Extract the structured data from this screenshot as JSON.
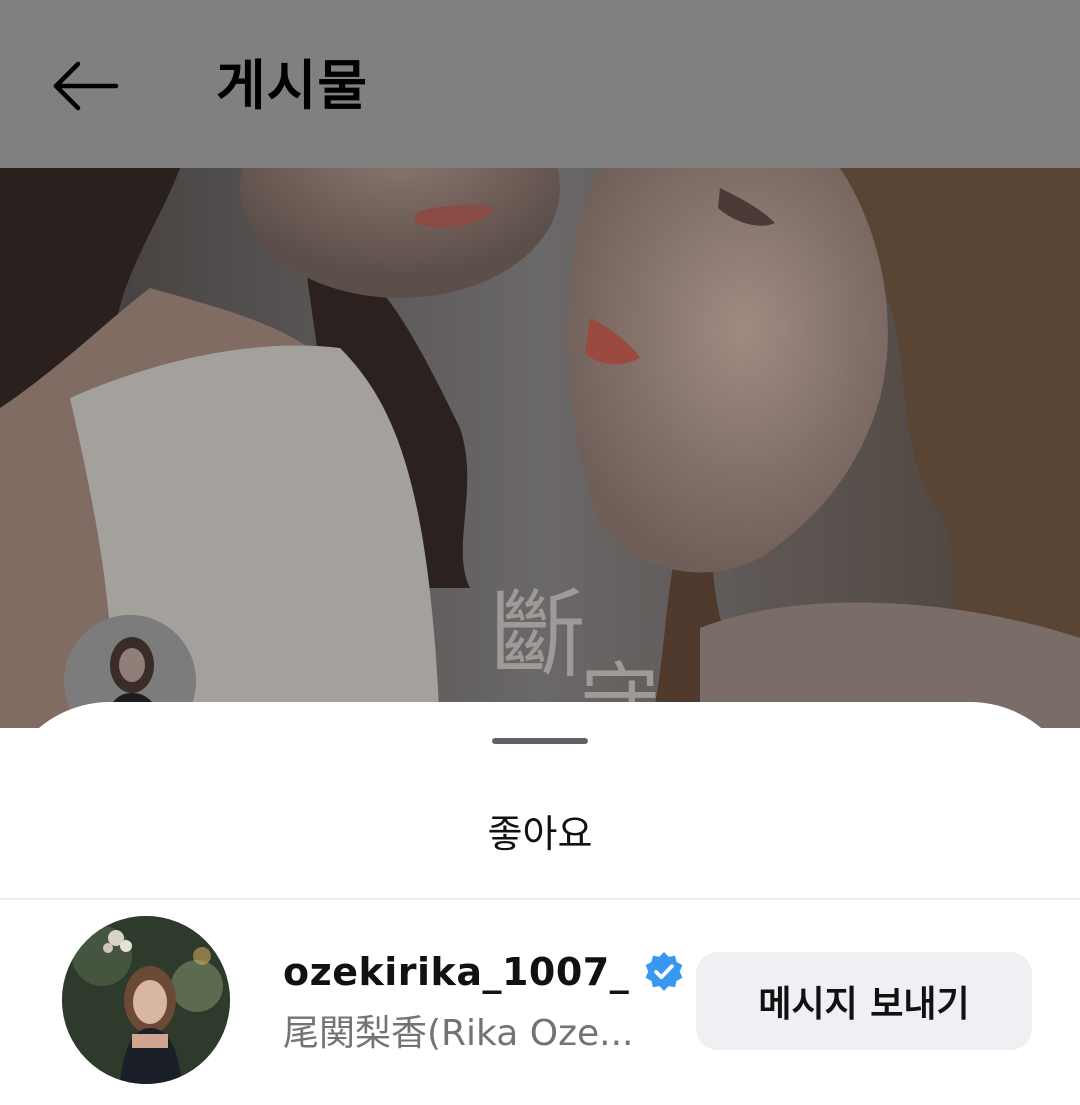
{
  "header": {
    "title": "게시물",
    "back_icon": "arrow-left-icon"
  },
  "post_image": {
    "overlay_text": "斷 守"
  },
  "sheet": {
    "title": "좋아요",
    "users": [
      {
        "username": "ozekirika_1007_",
        "full_name": "尾関梨香(Rika Oze...",
        "verified": true,
        "verified_icon": "verified-badge-icon",
        "button_label": "메시지 보내기"
      }
    ]
  },
  "colors": {
    "header_dim": "#808080",
    "verified_blue": "#3897f0",
    "button_bg": "#efeff4",
    "secondary_text": "#737373"
  }
}
